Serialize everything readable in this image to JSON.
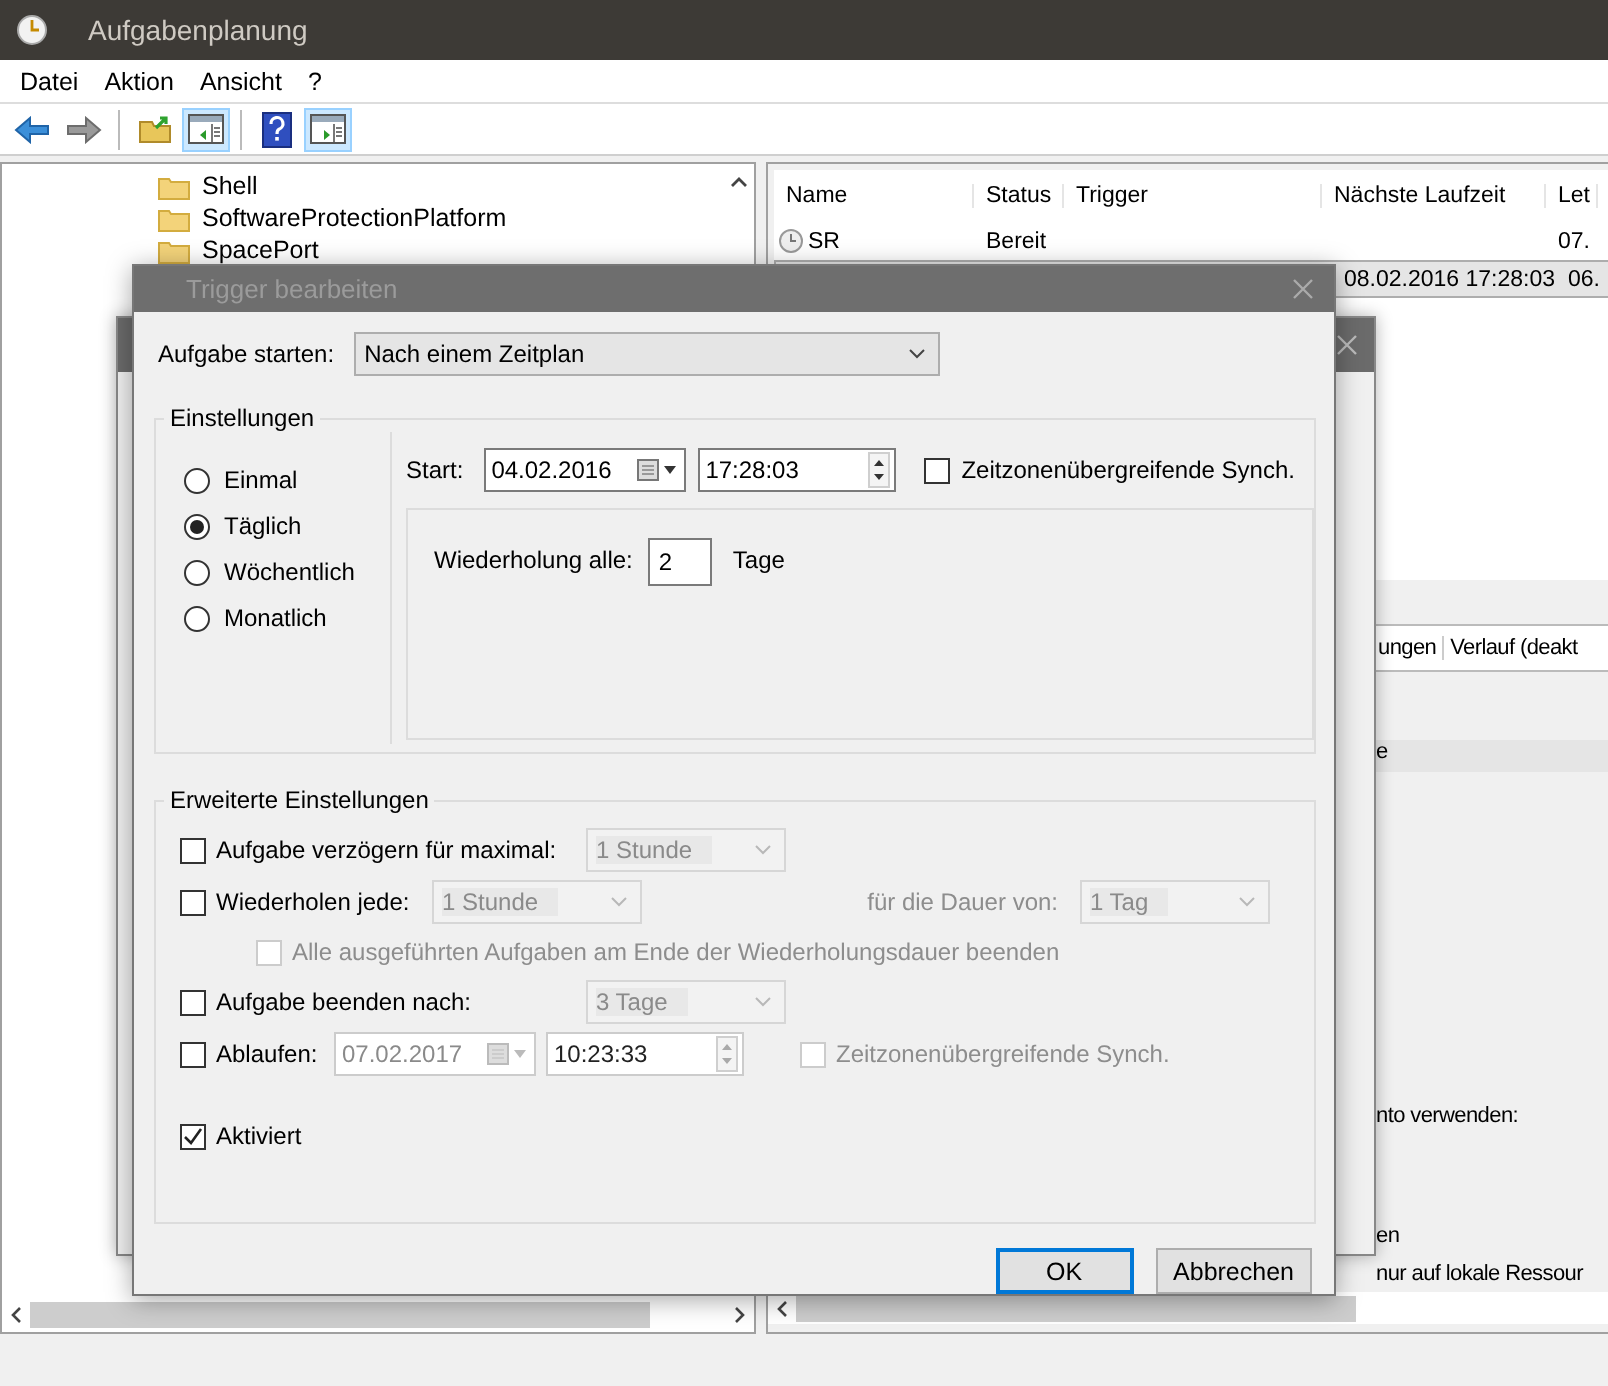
{
  "window": {
    "title": "Aufgabenplanung"
  },
  "menu": [
    "Datei",
    "Aktion",
    "Ansicht",
    "?"
  ],
  "toolbar": [
    {
      "kind": "back",
      "pressed": false
    },
    {
      "kind": "forward",
      "pressed": false
    },
    {
      "kind": "folder",
      "pressed": false
    },
    {
      "kind": "pane-left",
      "pressed": true
    },
    {
      "kind": "help",
      "pressed": false
    },
    {
      "kind": "pane-right",
      "pressed": true
    }
  ],
  "tree": {
    "items": [
      {
        "label": "Shell"
      },
      {
        "label": "SoftwareProtectionPlatform"
      },
      {
        "label": "SpacePort"
      }
    ]
  },
  "task_list": {
    "columns": [
      "Name",
      "Status",
      "Trigger",
      "Nächste Laufzeit",
      "Let"
    ],
    "rows": [
      {
        "name": "SR",
        "status": "Bereit",
        "last": "07.",
        "selected": false
      },
      {
        "next_run": "08.02.2016 17:28:03",
        "last": "06.",
        "selected": true
      }
    ]
  },
  "details": {
    "tabs": [
      "ungen",
      "Verlauf (deakt"
    ],
    "lines": [
      "e",
      "nto verwenden:",
      "en",
      "nur auf lokale Ressour"
    ]
  },
  "dialog": {
    "title": "Trigger bearbeiten",
    "start_label": "Aufgabe starten:",
    "start_value": "Nach einem Zeitplan",
    "settings": {
      "title": "Einstellungen",
      "schedules": [
        {
          "label": "Einmal",
          "selected": false
        },
        {
          "label": "Täglich",
          "selected": true
        },
        {
          "label": "Wöchentlich",
          "selected": false
        },
        {
          "label": "Monatlich",
          "selected": false
        }
      ],
      "start_label": "Start:",
      "date": "04.02.2016",
      "time": "17:28:03",
      "sync": {
        "label": "Zeitzonenübergreifende Synch.",
        "checked": false
      },
      "repeat_label": "Wiederholung alle:",
      "repeat_value": "2",
      "repeat_unit": "Tage"
    },
    "advanced": {
      "title": "Erweiterte Einstellungen",
      "delay": {
        "label": "Aufgabe verzögern für maximal:",
        "checked": false,
        "value": "1 Stunde"
      },
      "repeat": {
        "label": "Wiederholen jede:",
        "checked": false,
        "value": "1 Stunde",
        "duration_label": "für die Dauer von:",
        "duration_value": "1 Tag"
      },
      "stop_all": {
        "label": "Alle ausgeführten Aufgaben am Ende der Wiederholungsdauer beenden",
        "checked": false
      },
      "stop_after": {
        "label": "Aufgabe beenden nach:",
        "checked": false,
        "value": "3 Tage"
      },
      "expire": {
        "label": "Ablaufen:",
        "checked": false,
        "date": "07.02.2017",
        "time": "10:23:33",
        "sync_label": "Zeitzonenübergreifende Synch.",
        "sync_checked": false
      },
      "enabled": {
        "label": "Aktiviert",
        "checked": true
      }
    },
    "buttons": [
      {
        "label": "OK",
        "default": true
      },
      {
        "label": "Abbrechen",
        "default": false
      }
    ]
  }
}
